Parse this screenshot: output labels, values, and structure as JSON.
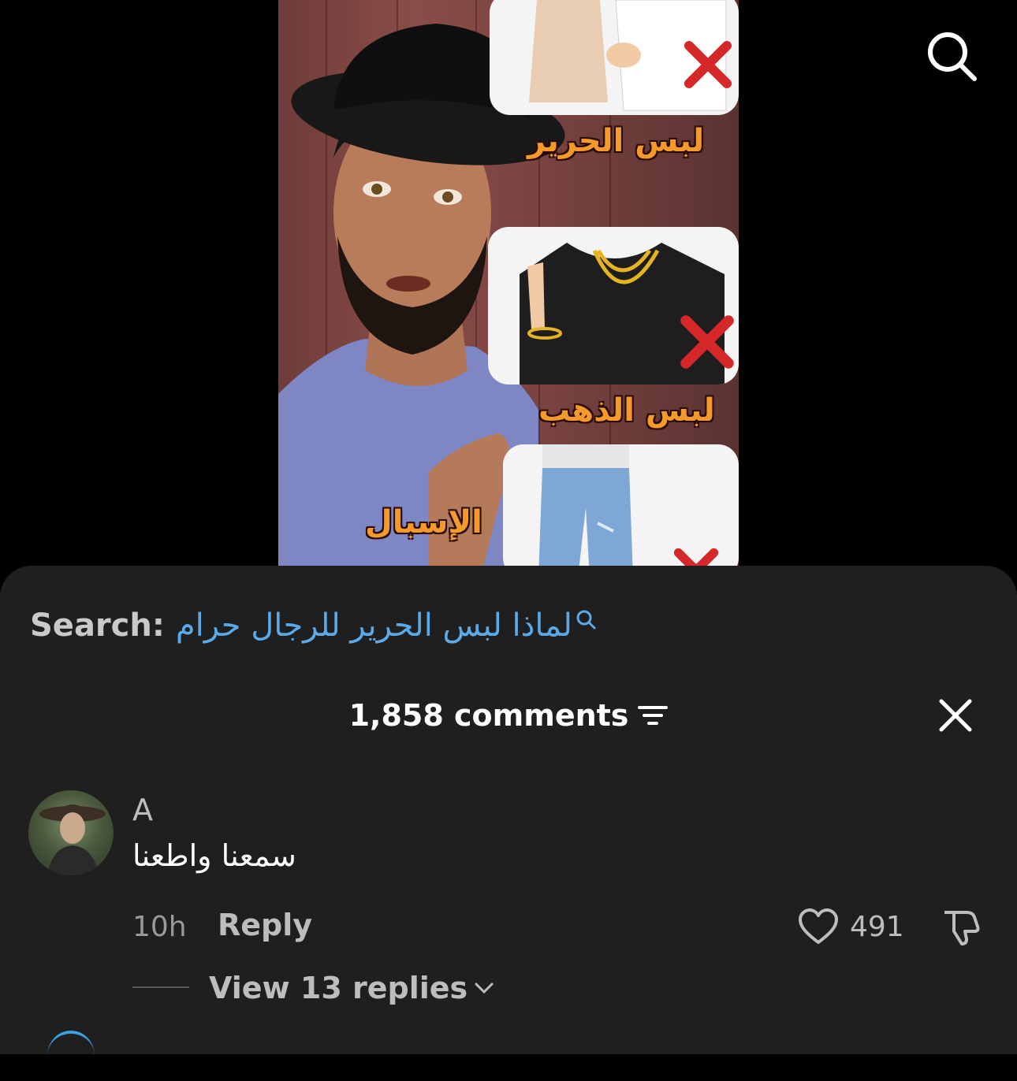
{
  "video": {
    "captions": [
      "لبس الحرير",
      "لبس الذهب",
      "الإسبال"
    ]
  },
  "search": {
    "label": "Search:",
    "query": "لماذا لبس الحرير للرجال حرام"
  },
  "comments_header": {
    "count_label": "1,858 comments"
  },
  "comment": {
    "username": "A",
    "text": "سمعنا واطعنا",
    "time": "10h",
    "reply_label": "Reply",
    "likes": "491",
    "view_replies_label": "View 13 replies"
  },
  "icons": {
    "top_right": "search-icon",
    "header_sort": "sort-icon",
    "header_close": "close-icon",
    "like": "heart-icon",
    "dislike": "thumbs-down-icon",
    "replies": "chevron-down-icon"
  },
  "colors": {
    "sheet_background": "#1f1f1f",
    "search_query": "#5aa9e8",
    "caption_orange": "#f39a2a",
    "cross_red": "#d62828"
  }
}
